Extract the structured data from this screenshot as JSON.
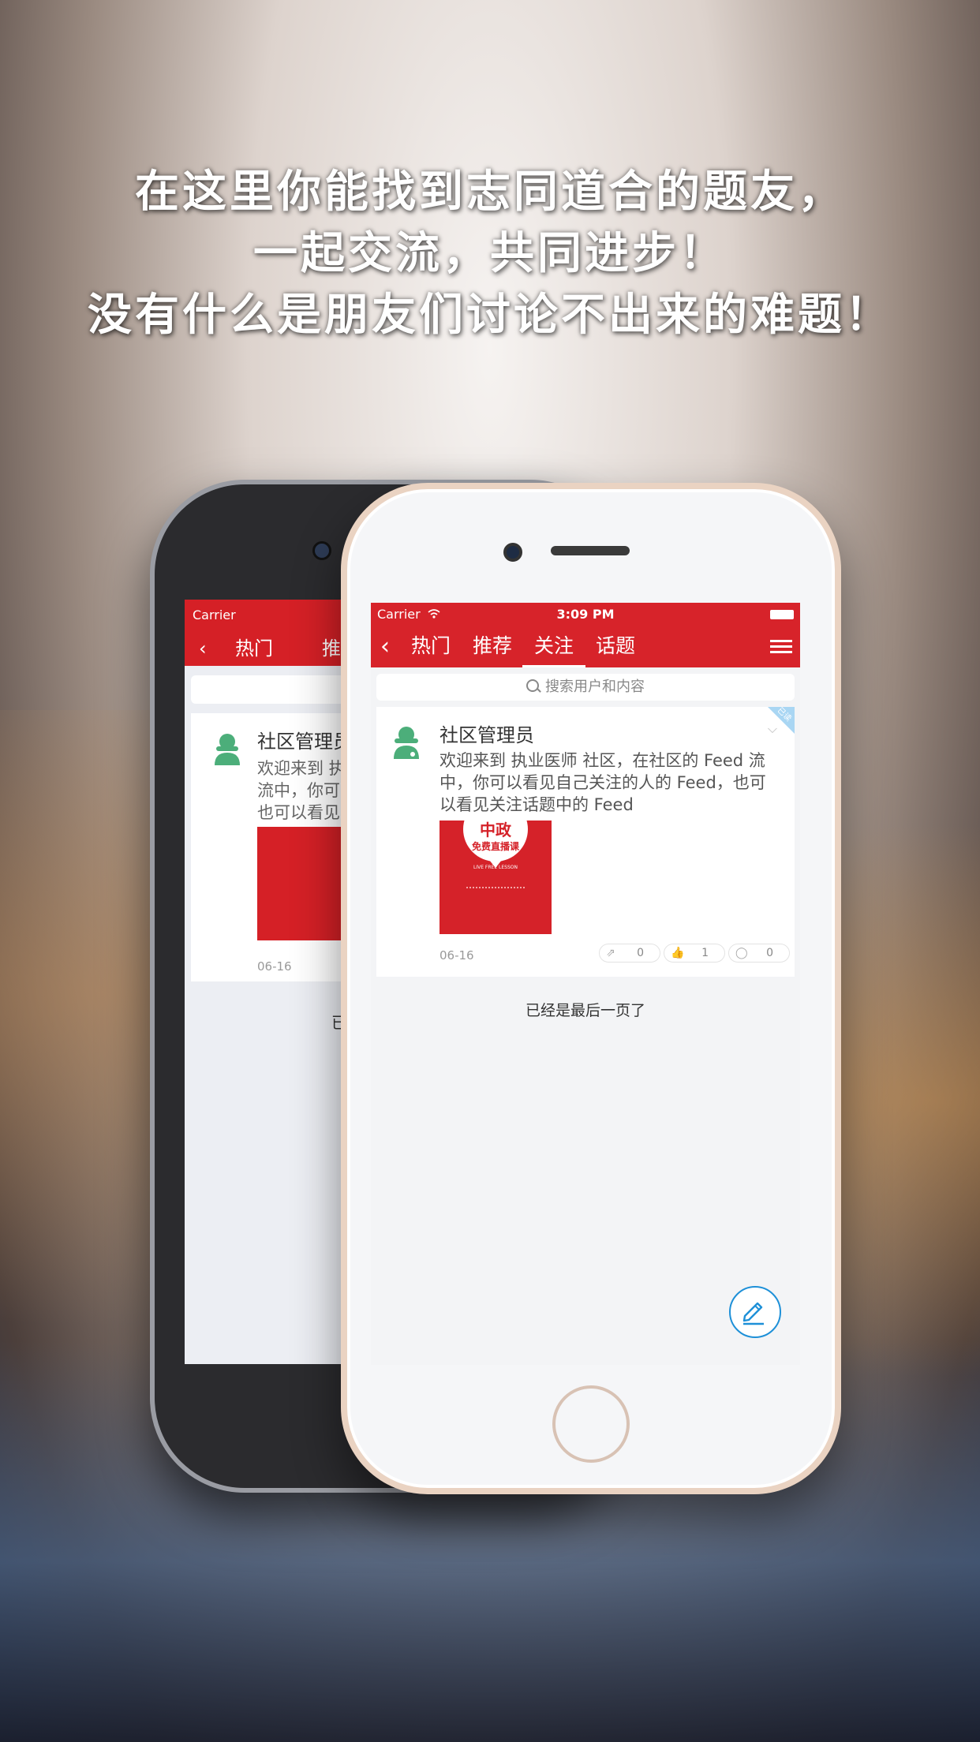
{
  "headline": {
    "line1": "在这里你能找到志同道合的题友，",
    "line2": "一起交流，共同进步！",
    "line3": "没有什么是朋友们讨论不出来的难题！"
  },
  "status_bar": {
    "carrier": "Carrier",
    "time": "3:09 PM"
  },
  "nav": {
    "tabs": [
      {
        "label": "热门"
      },
      {
        "label": "推荐"
      },
      {
        "label": "关注"
      },
      {
        "label": "话题"
      }
    ],
    "active_tab": "关注"
  },
  "search": {
    "placeholder": "搜索用户和内容"
  },
  "post": {
    "author": "社区管理员",
    "ribbon": "已读",
    "text": "欢迎来到 执业医师 社区，在社区的 Feed 流中，你可以看见自己关注的人的 Feed，也可以看见关注话题中的 Feed",
    "image_title": "中政",
    "image_sub": "免费直播课",
    "image_caption": "LIVE FREE LESSON",
    "date": "06-16",
    "share_count": "0",
    "like_count": "1",
    "comment_count": "0"
  },
  "footer_text": "已经是最后一页了",
  "back_phone": {
    "carrier": "Carrier",
    "tab1": "热门",
    "tab2_partial": "推",
    "author_partial": "社区管理员",
    "text_line1": "欢迎来到 执",
    "text_line2": "流中，你可以",
    "text_line3": "也可以看见关",
    "date": "06-16",
    "last_partial": "已"
  },
  "colors": {
    "brand_red": "#d7232a",
    "accent_blue": "#1e90d8",
    "avatar_green": "#4cae7a"
  }
}
